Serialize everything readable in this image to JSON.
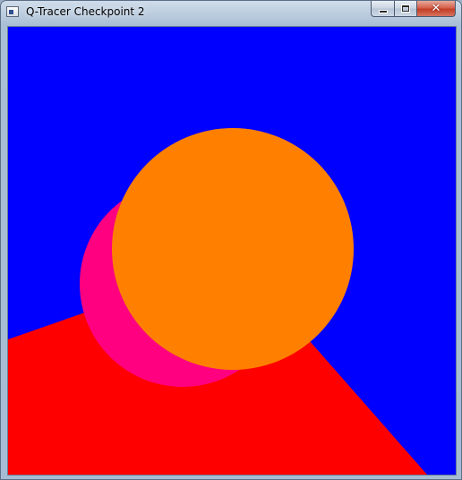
{
  "window": {
    "title": "Q-Tracer Checkpoint 2",
    "icon": "app-window-icon"
  },
  "caption_buttons": {
    "minimize": "minimize-icon",
    "maximize": "maximize-icon",
    "close": "close-icon"
  },
  "scene": {
    "colors": {
      "background": "#0000ff",
      "floor_plane": "#ff0000",
      "sphere_back": "#ff0080",
      "sphere_front": "#ff8000"
    }
  }
}
